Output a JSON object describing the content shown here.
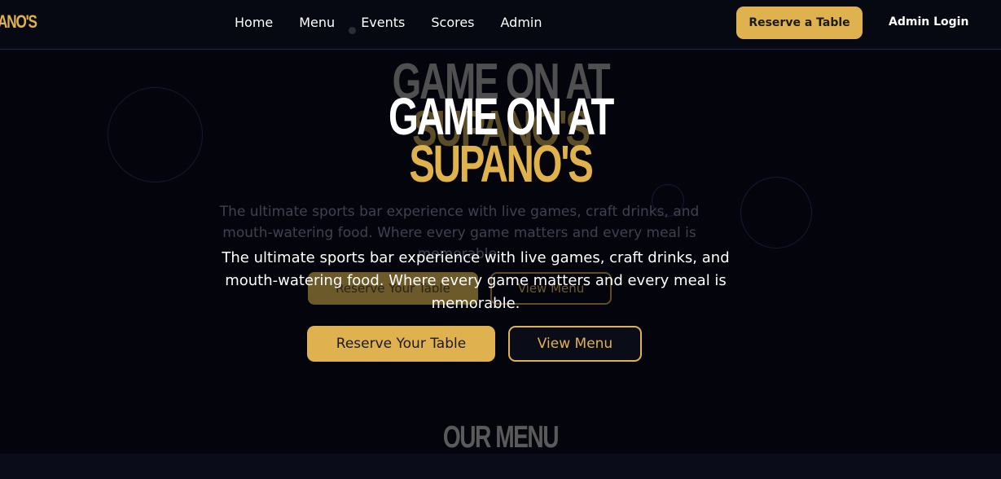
{
  "navbar": {
    "logo": "PANO'S",
    "links": [
      "Home",
      "Menu",
      "Events",
      "Scores",
      "Admin"
    ],
    "reserve_label": "Reserve a Table",
    "admin_login_label": "Admin Login"
  },
  "hero": {
    "title_line1": "GAME ON AT",
    "title_line2": "SUPANO'S",
    "subtitle": "The ultimate sports bar experience with live games, craft drinks, and mouth-watering food. Where every game matters and every meal is memorable.",
    "primary_button": "Reserve Your Table",
    "secondary_button": "View Menu"
  },
  "menu_section": {
    "heading": "OUR MENU"
  },
  "colors": {
    "accent": "#dfb14f",
    "background": "#04050c",
    "nav_border": "#1f2a4a"
  }
}
